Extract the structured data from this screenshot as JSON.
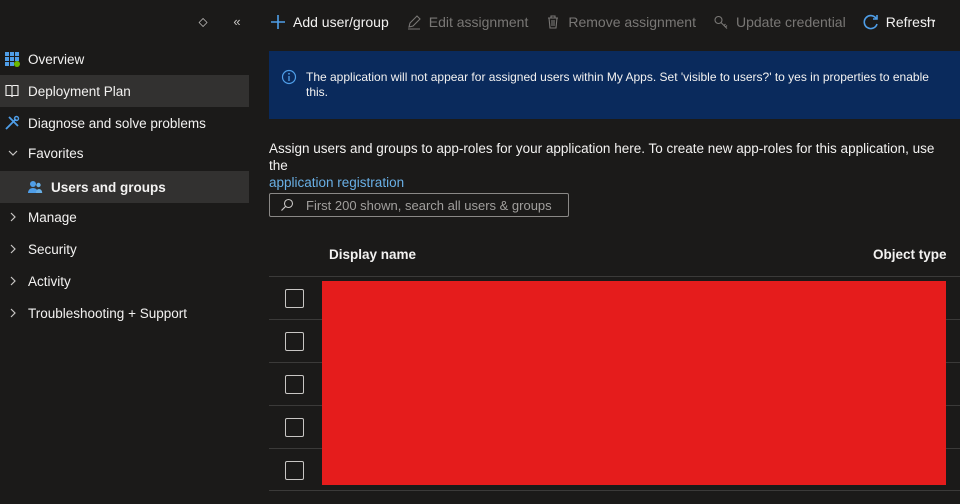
{
  "sidebar": {
    "top_icons": [
      "collapse-sort-icon",
      "double-chevron-left-icon"
    ],
    "items": [
      {
        "label": "Overview",
        "icon": "overview-grid-icon"
      },
      {
        "label": "Deployment Plan",
        "icon": "book-icon"
      },
      {
        "label": "Diagnose and solve problems",
        "icon": "wrench-icon"
      },
      {
        "label": "Favorites",
        "icon": "chevron-down-icon"
      },
      {
        "label": "Users and groups",
        "icon": "users-icon"
      },
      {
        "label": "Manage",
        "icon": "chevron-right-icon"
      },
      {
        "label": "Security",
        "icon": "chevron-right-icon"
      },
      {
        "label": "Activity",
        "icon": "chevron-right-icon"
      },
      {
        "label": "Troubleshooting + Support",
        "icon": "chevron-right-icon"
      }
    ]
  },
  "toolbar": {
    "add": "Add user/group",
    "edit": "Edit assignment",
    "remove": "Remove assignment",
    "update": "Update credential",
    "refresh": "Refresh",
    "more": "···"
  },
  "banner": {
    "text": "The application will not appear for assigned users within My Apps. Set 'visible to users?' to yes in properties to enable this."
  },
  "description": {
    "text": "Assign users and groups to app-roles for your application here. To create new app-roles for this application, use the",
    "link": "application registration"
  },
  "search": {
    "placeholder": "First 200 shown, search all users & groups"
  },
  "table": {
    "columns": [
      "Display name",
      "Object type"
    ],
    "row_count": 5
  },
  "colors": {
    "background": "#1b1a19",
    "selected": "#323130",
    "banner": "#0a2a5c",
    "accent": "#4f9ee8",
    "link": "#69afe5",
    "redaction": "#e51c1c"
  }
}
